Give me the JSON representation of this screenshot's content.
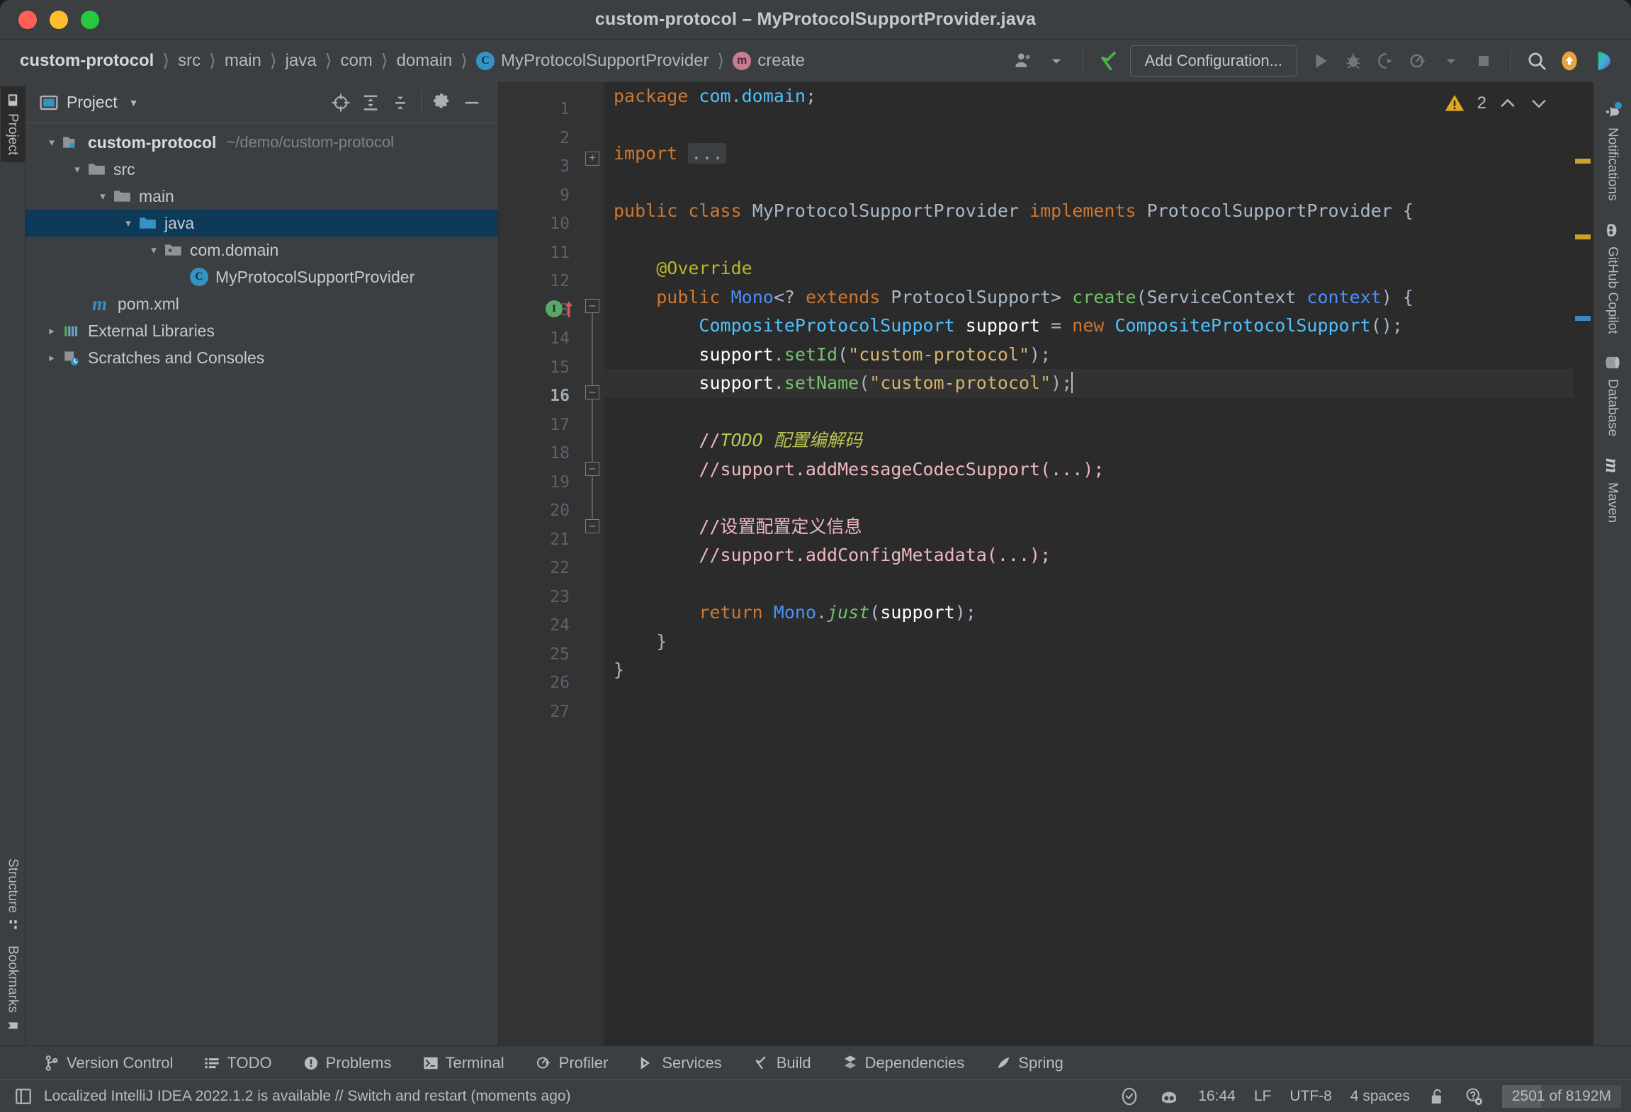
{
  "window": {
    "title": "custom-protocol – MyProtocolSupportProvider.java",
    "controls": {
      "close": "close",
      "minimize": "minimize",
      "maximize": "maximize"
    }
  },
  "breadcrumbs": [
    {
      "label": "custom-protocol",
      "icon": "",
      "root": true
    },
    {
      "label": "src",
      "icon": ""
    },
    {
      "label": "main",
      "icon": ""
    },
    {
      "label": "java",
      "icon": ""
    },
    {
      "label": "com",
      "icon": ""
    },
    {
      "label": "domain",
      "icon": ""
    },
    {
      "label": "MyProtocolSupportProvider",
      "icon": "class-icon",
      "glyph": "C"
    },
    {
      "label": "create",
      "icon": "method-icon",
      "glyph": "m"
    }
  ],
  "toolbar": {
    "user_icon": "user-icon",
    "build_icon": "build-hammer-icon",
    "add_configuration": "Add Configuration...",
    "run_icon": "run-icon",
    "debug_icon": "debug-icon",
    "run_coverage_icon": "run-with-coverage-icon",
    "profile_icon": "run-with-profiler-icon",
    "dropdown_icon": "chevron-down-icon",
    "stop_icon": "stop-icon",
    "search_icon": "search-everywhere-icon",
    "update_icon": "update-project-icon",
    "copilot_icon": "copilot-icon"
  },
  "project_panel": {
    "title": "Project",
    "dropdown_icon": "chevron-down-icon",
    "actions": [
      {
        "name": "locate-icon",
        "label": "Select Opened File"
      },
      {
        "name": "expand-all-icon",
        "label": "Expand All"
      },
      {
        "name": "collapse-all-icon",
        "label": "Collapse All"
      },
      {
        "name": "settings-gear-icon",
        "label": "Options"
      },
      {
        "name": "hide-icon",
        "label": "Hide"
      }
    ],
    "tree": [
      {
        "label": "custom-protocol",
        "sub": "~/demo/custom-protocol",
        "depth": 0,
        "arrow": "expanded",
        "icon": "module-folder-icon",
        "bold": true,
        "selected": false
      },
      {
        "label": "src",
        "sub": "",
        "depth": 1,
        "arrow": "expanded",
        "icon": "folder-icon",
        "bold": false,
        "selected": false
      },
      {
        "label": "main",
        "sub": "",
        "depth": 2,
        "arrow": "expanded",
        "icon": "folder-icon",
        "bold": false,
        "selected": false
      },
      {
        "label": "java",
        "sub": "",
        "depth": 3,
        "arrow": "expanded",
        "icon": "source-folder-icon",
        "bold": false,
        "selected": true
      },
      {
        "label": "com.domain",
        "sub": "",
        "depth": 4,
        "arrow": "expanded",
        "icon": "package-icon",
        "bold": false,
        "selected": false
      },
      {
        "label": "MyProtocolSupportProvider",
        "sub": "",
        "depth": 5,
        "arrow": "none",
        "icon": "class-icon",
        "bold": false,
        "selected": false
      },
      {
        "label": "pom.xml",
        "sub": "",
        "depth": 2,
        "arrow": "none",
        "icon": "maven-icon",
        "bold": false,
        "selected": false
      },
      {
        "label": "External Libraries",
        "sub": "",
        "depth": 0,
        "arrow": "collapsed",
        "icon": "libraries-icon",
        "bold": false,
        "selected": false
      },
      {
        "label": "Scratches and Consoles",
        "sub": "",
        "depth": 0,
        "arrow": "collapsed",
        "icon": "scratches-icon",
        "bold": false,
        "selected": false
      }
    ]
  },
  "left_strip": {
    "top": [
      {
        "label": "Project",
        "icon": "project-icon",
        "active": true
      }
    ],
    "bottom": [
      {
        "label": "Structure",
        "icon": "structure-icon",
        "active": false
      },
      {
        "label": "Bookmarks",
        "icon": "bookmarks-icon",
        "active": false
      }
    ]
  },
  "right_strip": [
    {
      "label": "Notifications",
      "icon": "notifications-bell-icon",
      "badge": true
    },
    {
      "label": "GitHub Copilot",
      "icon": "github-copilot-icon",
      "badge": false
    },
    {
      "label": "Database",
      "icon": "database-icon",
      "badge": false
    },
    {
      "label": "Maven",
      "icon": "maven-icon",
      "badge": false
    }
  ],
  "editor": {
    "file": "MyProtocolSupportProvider.java",
    "line_numbers": [
      1,
      2,
      3,
      9,
      10,
      11,
      12,
      13,
      14,
      15,
      16,
      17,
      18,
      19,
      20,
      21,
      22,
      23,
      24,
      25,
      26,
      27
    ],
    "current_line": 16,
    "warning_count": "2",
    "warning_icon": "warning-triangle-icon",
    "prev_icon": "chevron-up-icon",
    "next_icon": "chevron-down-icon",
    "code_lines": [
      {
        "n": 1,
        "text": "package com.domain;"
      },
      {
        "n": 2,
        "text": ""
      },
      {
        "n": 3,
        "text": "import ..."
      },
      {
        "n": 9,
        "text": ""
      },
      {
        "n": 10,
        "text": "public class MyProtocolSupportProvider implements ProtocolSupportProvider {"
      },
      {
        "n": 11,
        "text": ""
      },
      {
        "n": 12,
        "text": "    @Override"
      },
      {
        "n": 13,
        "text": "    public Mono<? extends ProtocolSupport> create(ServiceContext context) {"
      },
      {
        "n": 14,
        "text": "        CompositeProtocolSupport support = new CompositeProtocolSupport();"
      },
      {
        "n": 15,
        "text": "        support.setId(\"custom-protocol\");"
      },
      {
        "n": 16,
        "text": "        support.setName(\"custom-protocol\");"
      },
      {
        "n": 17,
        "text": ""
      },
      {
        "n": 18,
        "text": "        //TODO 配置编解码"
      },
      {
        "n": 19,
        "text": "        //support.addMessageCodecSupport(...);"
      },
      {
        "n": 20,
        "text": ""
      },
      {
        "n": 21,
        "text": "        //设置配置定义信息"
      },
      {
        "n": 22,
        "text": "        //support.addConfigMetadata(...);"
      },
      {
        "n": 23,
        "text": ""
      },
      {
        "n": 24,
        "text": "        return Mono.just(support);"
      },
      {
        "n": 25,
        "text": "    }"
      },
      {
        "n": 26,
        "text": "}"
      },
      {
        "n": 27,
        "text": ""
      }
    ],
    "gutter_markers": [
      {
        "line": 13,
        "icon": "implementing-method-icon",
        "glyph": "I"
      }
    ],
    "colors": {
      "background": "#2b2b2b",
      "gutter": "#313335",
      "keyword": "#cc7832",
      "string": "#d5b26a",
      "comment": "#f0b7c0",
      "todo": "#b9c54f",
      "class_ref": "#4fc1ff",
      "method": "#72c16b",
      "parameter": "#4b8ff7",
      "annotation": "#bbb529",
      "plain": "#a9b7c6",
      "selection": "#0d3a58"
    },
    "scrollbar_marks": [
      {
        "pos_pct": 10.5,
        "color": "#c9a227"
      },
      {
        "pos_pct": 28.5,
        "color": "#c9a227"
      },
      {
        "pos_pct": 47.0,
        "color": "#3a88c8"
      }
    ]
  },
  "bottom_toolwindows": [
    {
      "label": "Version Control",
      "icon": "branch-icon"
    },
    {
      "label": "TODO",
      "icon": "todo-list-icon"
    },
    {
      "label": "Problems",
      "icon": "problems-icon"
    },
    {
      "label": "Terminal",
      "icon": "terminal-icon"
    },
    {
      "label": "Profiler",
      "icon": "profiler-icon"
    },
    {
      "label": "Services",
      "icon": "services-icon"
    },
    {
      "label": "Build",
      "icon": "build-hammer-icon"
    },
    {
      "label": "Dependencies",
      "icon": "dependencies-icon"
    },
    {
      "label": "Spring",
      "icon": "spring-leaf-icon"
    }
  ],
  "status_bar": {
    "left_icon": "toggle-toolwindows-icon",
    "message": "Localized IntelliJ IDEA 2022.1.2 is available // Switch and restart (moments ago)",
    "inspections_icon": "inspections-widget-icon",
    "copilot_icon": "copilot-status-icon",
    "time": "16:44",
    "line_separator": "LF",
    "encoding": "UTF-8",
    "indent": "4 spaces",
    "lock_icon": "unlocked-icon",
    "gear_help_icon": "ide-settings-icon",
    "memory": "2501 of 8192M"
  }
}
